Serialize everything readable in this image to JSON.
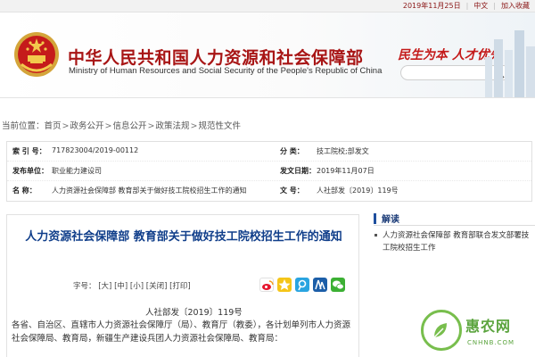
{
  "topbar": {
    "date": "2019年11月25日",
    "lang_cn": "中文",
    "add_favorite": "加入收藏"
  },
  "header": {
    "title_cn": "中华人民共和国人力资源和社会保障部",
    "title_en": "Ministry of Human Resources and Social Security of the People's Republic of China",
    "slogan": "民生为本 人才优先",
    "search_placeholder": ""
  },
  "breadcrumb": {
    "prefix": "当前位置：",
    "items": [
      "首页",
      "政务公开",
      "信息公开",
      "政策法规",
      "规范性文件"
    ]
  },
  "meta": {
    "index_label": "索 引 号：",
    "index_value": "717823004/2019-00112",
    "category_label": "分  类：",
    "category_value": "技工院校;部发文",
    "issuer_label": "发布单位：",
    "issuer_value": "职业能力建设司",
    "date_label": "发文日期：",
    "date_value": "2019年11月07日",
    "name_label": "名  称：",
    "name_value": "人力资源社会保障部 教育部关于做好技工院校招生工作的通知",
    "docno_label": "文  号：",
    "docno_value": "人社部发〔2019〕119号"
  },
  "article": {
    "title": "人力资源社会保障部 教育部关于做好技工院校招生工作的通知",
    "fontsize_label": "字号：",
    "fontsize_large": "[大]",
    "fontsize_medium": "[中]",
    "fontsize_small": "[小]",
    "close": "[关闭]",
    "print": "[打印]",
    "docno": "人社部发〔2019〕119号",
    "body": "各省、自治区、直辖市人力资源社会保障厅（局）、教育厅（教委），各计划单列市人力资源社会保障局、教育局，新疆生产建设兵团人力资源社会保障局、教育局："
  },
  "sidebar": {
    "heading": "解读",
    "items": [
      "人力资源社会保障部 教育部联合发文部署技工院校招生工作"
    ]
  },
  "watermark": {
    "text": "惠农网",
    "url": "CNHNB.COM"
  },
  "colors": {
    "brand_red": "#a81515",
    "title_blue": "#103e8a",
    "accent_blue": "#1f4f9e"
  }
}
